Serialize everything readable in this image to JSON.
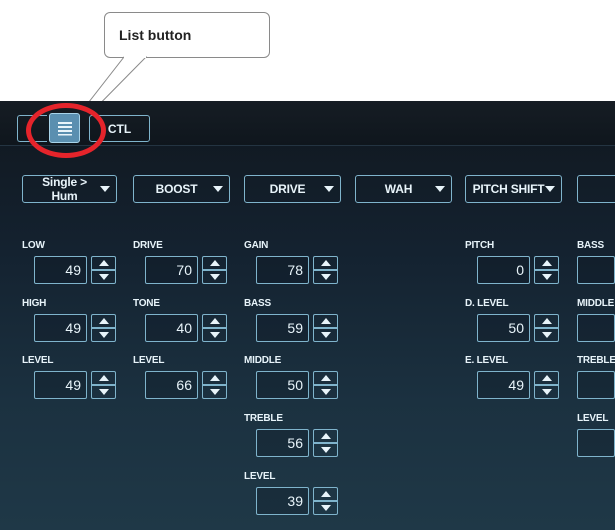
{
  "callout": {
    "text": "List button"
  },
  "toolbar": {
    "first_icon": "grid-icon",
    "list_icon": "list-icon",
    "ctl_label": "CTL"
  },
  "effects": [
    {
      "label": "Single > Hum",
      "params": [
        {
          "label": "LOW",
          "value": "49"
        },
        {
          "label": "HIGH",
          "value": "49"
        },
        {
          "label": "LEVEL",
          "value": "49"
        }
      ]
    },
    {
      "label": "BOOST",
      "params": [
        {
          "label": "DRIVE",
          "value": "70"
        },
        {
          "label": "TONE",
          "value": "40"
        },
        {
          "label": "LEVEL",
          "value": "66"
        }
      ]
    },
    {
      "label": "DRIVE",
      "params": [
        {
          "label": "GAIN",
          "value": "78"
        },
        {
          "label": "BASS",
          "value": "59"
        },
        {
          "label": "MIDDLE",
          "value": "50"
        },
        {
          "label": "TREBLE",
          "value": "56"
        },
        {
          "label": "LEVEL",
          "value": "39"
        }
      ]
    },
    {
      "label": "WAH",
      "params": []
    },
    {
      "label": "PITCH SHIFT",
      "params": [
        {
          "label": "PITCH",
          "value": "0"
        },
        {
          "label": "D. LEVEL",
          "value": "50"
        },
        {
          "label": "E. LEVEL",
          "value": "49"
        }
      ]
    },
    {
      "label": "",
      "params": [
        {
          "label": "BASS",
          "value": ""
        },
        {
          "label": "MIDDLE",
          "value": ""
        },
        {
          "label": "TREBLE",
          "value": ""
        },
        {
          "label": "LEVEL",
          "value": ""
        }
      ]
    }
  ],
  "colors": {
    "highlight_ring": "#e5242b",
    "accent": "#7fb4cc",
    "list_active": "#5a8fb0"
  }
}
